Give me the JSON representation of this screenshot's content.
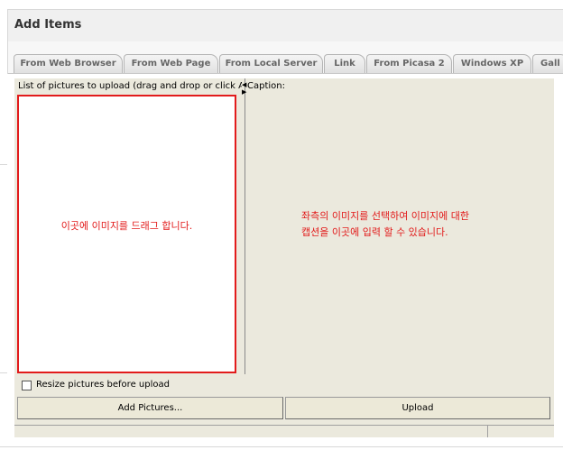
{
  "header": {
    "title": "Add Items"
  },
  "tabs": [
    {
      "label": "From Web Browser"
    },
    {
      "label": "From Web Page"
    },
    {
      "label": "From Local Server"
    },
    {
      "label": "Link"
    },
    {
      "label": "From Picasa 2"
    },
    {
      "label": "Windows XP"
    },
    {
      "label": "Gall"
    }
  ],
  "uploader": {
    "list_header": "List of pictures to upload (drag and drop or click Ad",
    "caption_label": "Caption:",
    "drop_hint": "이곳에 이미지를 드래그 합니다.",
    "caption_hint_line1": "좌측의 이미지를 선택하여 이미지에 대한",
    "caption_hint_line2": "캡션을 이곳에 입력 할 수 있습니다.",
    "resize_label": "Resize pictures before upload",
    "resize_checked": false,
    "add_pictures_label": "Add Pictures...",
    "upload_label": "Upload"
  },
  "colors": {
    "accent_red": "#e21b1b",
    "applet_bg": "#ebe9dd"
  }
}
